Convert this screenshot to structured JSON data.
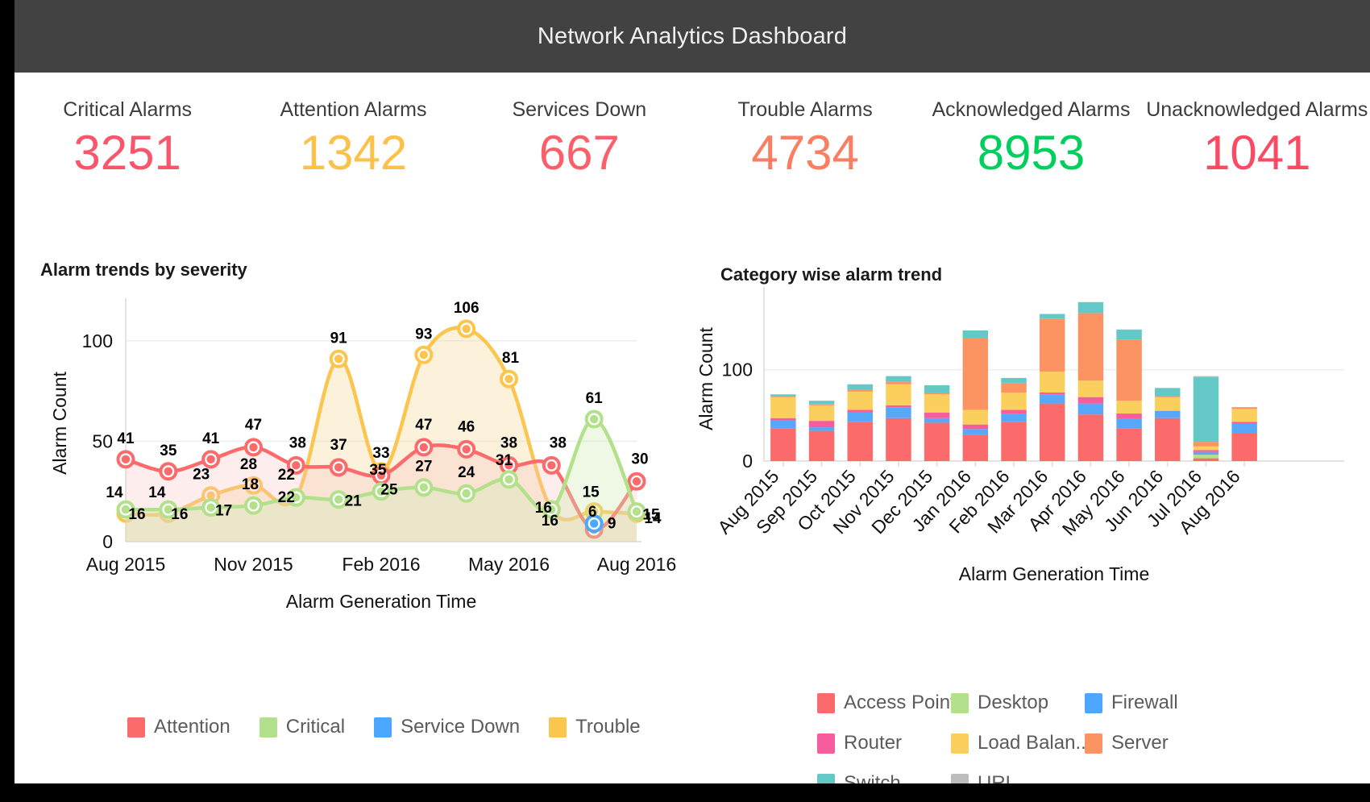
{
  "header": {
    "title": "Network Analytics Dashboard",
    "bg_color": "#424242",
    "text_color": "#f0f0f0"
  },
  "kpis": [
    {
      "label": "Critical Alarms",
      "value": "3251",
      "color": "#f9556b"
    },
    {
      "label": "Attention Alarms",
      "value": "1342",
      "color": "#fbc14b"
    },
    {
      "label": "Services Down",
      "value": "667",
      "color": "#fb5f6a"
    },
    {
      "label": "Trouble Alarms",
      "value": "4734",
      "color": "#fa7e62"
    },
    {
      "label": "Acknowledged Alarms",
      "value": "8953",
      "color": "#00cf5d"
    },
    {
      "label": "Unacknowledged Alarms",
      "value": "1041",
      "color": "#fb4a63"
    }
  ],
  "panels": {
    "left_title": "Alarm trends by severity",
    "right_title": "Category wise alarm trend"
  },
  "chart_data": [
    {
      "type": "line",
      "title": "Alarm trends by severity",
      "xlabel": "Alarm Generation Time",
      "ylabel": "Alarm Count",
      "ylim": [
        0,
        118
      ],
      "yticks": [
        0,
        50,
        100
      ],
      "ytick_labels": [
        "0",
        "50",
        "100"
      ],
      "grid": true,
      "legend_position": "bottom",
      "x": [
        "Aug 2015",
        "Sep 2015",
        "Oct 2015",
        "Nov 2015",
        "Dec 2015",
        "Jan 2016",
        "Feb 2016",
        "Mar 2016",
        "Apr 2016",
        "May 2016",
        "Jun 2016",
        "Jul 2016",
        "Aug 2016"
      ],
      "xtick_labels": [
        "Aug 2015",
        "Nov 2015",
        "Feb 2016",
        "May 2016",
        "Aug 2016"
      ],
      "xtick_indices": [
        0,
        3,
        6,
        9,
        12
      ],
      "series": [
        {
          "name": "Attention",
          "color": "#fb6b6b",
          "values": [
            41,
            35,
            41,
            47,
            38,
            37,
            33,
            47,
            46,
            38,
            38,
            6,
            30
          ]
        },
        {
          "name": "Critical",
          "color": "#b3e08a",
          "values": [
            16,
            16,
            17,
            18,
            22,
            21,
            25,
            27,
            24,
            31,
            16,
            61,
            15
          ]
        },
        {
          "name": "Service Down",
          "color": "#4da6ff",
          "values": [
            null,
            null,
            null,
            null,
            null,
            null,
            null,
            null,
            null,
            null,
            null,
            9,
            null
          ]
        },
        {
          "name": "Trouble",
          "color": "#fbc54e",
          "values": [
            14,
            14,
            23,
            28,
            22,
            91,
            35,
            93,
            106,
            81,
            16,
            15,
            14
          ]
        }
      ],
      "point_labels": {
        "Attention": [
          "41",
          "35",
          "41",
          "47",
          "38",
          "37",
          "33",
          "47",
          "46",
          "38",
          "38",
          "6",
          "30"
        ],
        "Critical": [
          "16",
          "16",
          "17",
          "18",
          "22",
          "21",
          "25",
          "27",
          "24",
          "31",
          "16",
          "61",
          "15"
        ],
        "Service Down": [
          null,
          null,
          null,
          null,
          null,
          null,
          null,
          null,
          null,
          null,
          null,
          "9",
          null
        ],
        "Trouble": [
          "14",
          "14",
          "23",
          "28",
          "22",
          "91",
          "35",
          "93",
          "106",
          "81",
          "16",
          "15",
          "14"
        ]
      }
    },
    {
      "type": "bar",
      "subtype": "stacked",
      "title": "Category wise alarm trend",
      "xlabel": "Alarm Generation Time",
      "ylabel": "Alarm Count",
      "ylim": [
        0,
        180
      ],
      "yticks": [
        0,
        100
      ],
      "ytick_labels": [
        "0",
        "100"
      ],
      "grid": true,
      "legend_position": "bottom",
      "categories": [
        "Aug 2015",
        "Sep 2015",
        "Oct 2015",
        "Nov 2015",
        "Dec 2015",
        "Jan 2016",
        "Feb 2016",
        "Mar 2016",
        "Apr 2016",
        "May 2016",
        "Jun 2016",
        "Jul 2016",
        "Aug 2016"
      ],
      "series": [
        {
          "name": "Access Point",
          "color": "#fb6b6b",
          "values": [
            36,
            33,
            43,
            47,
            42,
            29,
            43,
            63,
            51,
            36,
            47,
            3,
            30
          ]
        },
        {
          "name": "Desktop",
          "color": "#b3e08a",
          "values": [
            0,
            0,
            0,
            0,
            0,
            0,
            0,
            0,
            0,
            0,
            0,
            4,
            0
          ]
        },
        {
          "name": "Firewall",
          "color": "#57a7fb",
          "values": [
            9,
            4,
            10,
            12,
            5,
            6,
            9,
            10,
            12,
            10,
            8,
            3,
            11
          ]
        },
        {
          "name": "Router",
          "color": "#f75c9c",
          "values": [
            2,
            7,
            3,
            2,
            6,
            5,
            4,
            2,
            7,
            6,
            0,
            2,
            2
          ]
        },
        {
          "name": "Load Balan...",
          "color": "#fbcf5e",
          "values": [
            23,
            17,
            20,
            23,
            20,
            16,
            19,
            23,
            18,
            14,
            15,
            4,
            14
          ]
        },
        {
          "name": "Server",
          "color": "#fb9362",
          "values": [
            1,
            1,
            2,
            3,
            2,
            79,
            10,
            58,
            74,
            67,
            1,
            5,
            2
          ]
        },
        {
          "name": "Switch",
          "color": "#64c9c6",
          "values": [
            2,
            4,
            6,
            6,
            8,
            8,
            6,
            5,
            12,
            11,
            9,
            71,
            0
          ]
        },
        {
          "name": "URL",
          "color": "#bdbdbd",
          "values": [
            0,
            0,
            0,
            0,
            0,
            0,
            0,
            0,
            0,
            0,
            0,
            1,
            0
          ]
        }
      ],
      "totals": [
        73,
        66,
        84,
        93,
        83,
        143,
        91,
        161,
        174,
        144,
        80,
        93,
        59
      ]
    }
  ],
  "legends": {
    "line_chart": [
      {
        "label": "Attention",
        "color": "#fb6b6b"
      },
      {
        "label": "Critical",
        "color": "#b3e08a"
      },
      {
        "label": "Service Down",
        "color": "#4da6ff"
      },
      {
        "label": "Trouble",
        "color": "#fbc54e"
      }
    ],
    "bar_chart": [
      {
        "label": "Access Point",
        "color": "#fb6b6b"
      },
      {
        "label": "Desktop",
        "color": "#b3e08a"
      },
      {
        "label": "Firewall",
        "color": "#4da6ff"
      },
      {
        "label": "Router",
        "color": "#f75c9c"
      },
      {
        "label": "Load Balan...",
        "color": "#fbcf5e"
      },
      {
        "label": "Server",
        "color": "#fb9362"
      },
      {
        "label": "Switch",
        "color": "#64c9c6"
      },
      {
        "label": "URL",
        "color": "#bdbdbd"
      }
    ]
  }
}
